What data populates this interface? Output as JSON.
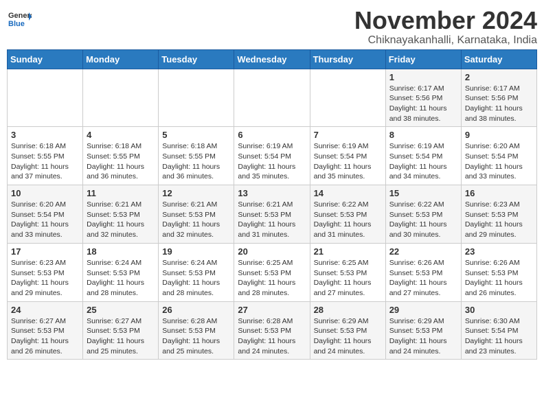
{
  "logo": {
    "general": "General",
    "blue": "Blue"
  },
  "header": {
    "month": "November 2024",
    "location": "Chiknayakanhalli, Karnataka, India"
  },
  "weekdays": [
    "Sunday",
    "Monday",
    "Tuesday",
    "Wednesday",
    "Thursday",
    "Friday",
    "Saturday"
  ],
  "weeks": [
    [
      null,
      null,
      null,
      null,
      null,
      {
        "day": 1,
        "sunrise": "6:17 AM",
        "sunset": "5:56 PM",
        "daylight": "11 hours and 38 minutes."
      },
      {
        "day": 2,
        "sunrise": "6:17 AM",
        "sunset": "5:56 PM",
        "daylight": "11 hours and 38 minutes."
      }
    ],
    [
      {
        "day": 3,
        "sunrise": "6:18 AM",
        "sunset": "5:55 PM",
        "daylight": "11 hours and 37 minutes."
      },
      {
        "day": 4,
        "sunrise": "6:18 AM",
        "sunset": "5:55 PM",
        "daylight": "11 hours and 36 minutes."
      },
      {
        "day": 5,
        "sunrise": "6:18 AM",
        "sunset": "5:55 PM",
        "daylight": "11 hours and 36 minutes."
      },
      {
        "day": 6,
        "sunrise": "6:19 AM",
        "sunset": "5:54 PM",
        "daylight": "11 hours and 35 minutes."
      },
      {
        "day": 7,
        "sunrise": "6:19 AM",
        "sunset": "5:54 PM",
        "daylight": "11 hours and 35 minutes."
      },
      {
        "day": 8,
        "sunrise": "6:19 AM",
        "sunset": "5:54 PM",
        "daylight": "11 hours and 34 minutes."
      },
      {
        "day": 9,
        "sunrise": "6:20 AM",
        "sunset": "5:54 PM",
        "daylight": "11 hours and 33 minutes."
      }
    ],
    [
      {
        "day": 10,
        "sunrise": "6:20 AM",
        "sunset": "5:54 PM",
        "daylight": "11 hours and 33 minutes."
      },
      {
        "day": 11,
        "sunrise": "6:21 AM",
        "sunset": "5:53 PM",
        "daylight": "11 hours and 32 minutes."
      },
      {
        "day": 12,
        "sunrise": "6:21 AM",
        "sunset": "5:53 PM",
        "daylight": "11 hours and 32 minutes."
      },
      {
        "day": 13,
        "sunrise": "6:21 AM",
        "sunset": "5:53 PM",
        "daylight": "11 hours and 31 minutes."
      },
      {
        "day": 14,
        "sunrise": "6:22 AM",
        "sunset": "5:53 PM",
        "daylight": "11 hours and 31 minutes."
      },
      {
        "day": 15,
        "sunrise": "6:22 AM",
        "sunset": "5:53 PM",
        "daylight": "11 hours and 30 minutes."
      },
      {
        "day": 16,
        "sunrise": "6:23 AM",
        "sunset": "5:53 PM",
        "daylight": "11 hours and 29 minutes."
      }
    ],
    [
      {
        "day": 17,
        "sunrise": "6:23 AM",
        "sunset": "5:53 PM",
        "daylight": "11 hours and 29 minutes."
      },
      {
        "day": 18,
        "sunrise": "6:24 AM",
        "sunset": "5:53 PM",
        "daylight": "11 hours and 28 minutes."
      },
      {
        "day": 19,
        "sunrise": "6:24 AM",
        "sunset": "5:53 PM",
        "daylight": "11 hours and 28 minutes."
      },
      {
        "day": 20,
        "sunrise": "6:25 AM",
        "sunset": "5:53 PM",
        "daylight": "11 hours and 28 minutes."
      },
      {
        "day": 21,
        "sunrise": "6:25 AM",
        "sunset": "5:53 PM",
        "daylight": "11 hours and 27 minutes."
      },
      {
        "day": 22,
        "sunrise": "6:26 AM",
        "sunset": "5:53 PM",
        "daylight": "11 hours and 27 minutes."
      },
      {
        "day": 23,
        "sunrise": "6:26 AM",
        "sunset": "5:53 PM",
        "daylight": "11 hours and 26 minutes."
      }
    ],
    [
      {
        "day": 24,
        "sunrise": "6:27 AM",
        "sunset": "5:53 PM",
        "daylight": "11 hours and 26 minutes."
      },
      {
        "day": 25,
        "sunrise": "6:27 AM",
        "sunset": "5:53 PM",
        "daylight": "11 hours and 25 minutes."
      },
      {
        "day": 26,
        "sunrise": "6:28 AM",
        "sunset": "5:53 PM",
        "daylight": "11 hours and 25 minutes."
      },
      {
        "day": 27,
        "sunrise": "6:28 AM",
        "sunset": "5:53 PM",
        "daylight": "11 hours and 24 minutes."
      },
      {
        "day": 28,
        "sunrise": "6:29 AM",
        "sunset": "5:53 PM",
        "daylight": "11 hours and 24 minutes."
      },
      {
        "day": 29,
        "sunrise": "6:29 AM",
        "sunset": "5:53 PM",
        "daylight": "11 hours and 24 minutes."
      },
      {
        "day": 30,
        "sunrise": "6:30 AM",
        "sunset": "5:54 PM",
        "daylight": "11 hours and 23 minutes."
      }
    ]
  ]
}
